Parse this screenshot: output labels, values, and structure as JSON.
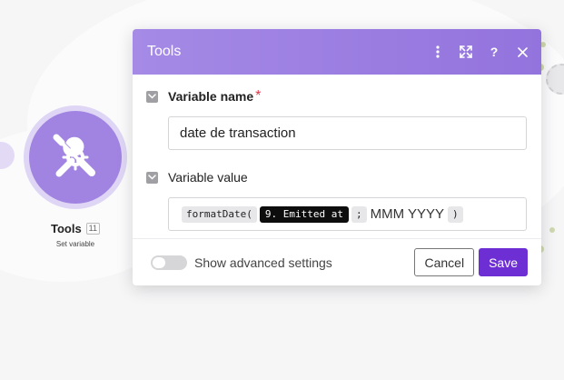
{
  "colors": {
    "accent": "#6d2fd3",
    "header": "#9b7ee0",
    "module": "#a184e2",
    "required": "#e0364b"
  },
  "module": {
    "title": "Tools",
    "badge": "11",
    "subtitle": "Set variable",
    "icon": "tools-icon"
  },
  "dialog": {
    "title": "Tools",
    "header_icons": [
      "more-vertical-icon",
      "expand-icon",
      "help-icon",
      "close-icon"
    ],
    "help_glyph": "?",
    "fields": {
      "name": {
        "label": "Variable name",
        "required_mark": "*",
        "value": "date de transaction"
      },
      "value": {
        "label": "Variable value",
        "tokens": {
          "func": "formatDate(",
          "var": "9. Emitted at",
          "sep": ";",
          "format": "MMM YYYY",
          "close": ")"
        }
      }
    },
    "footer": {
      "advanced_label": "Show advanced settings",
      "advanced_on": false,
      "cancel": "Cancel",
      "save": "Save"
    }
  }
}
